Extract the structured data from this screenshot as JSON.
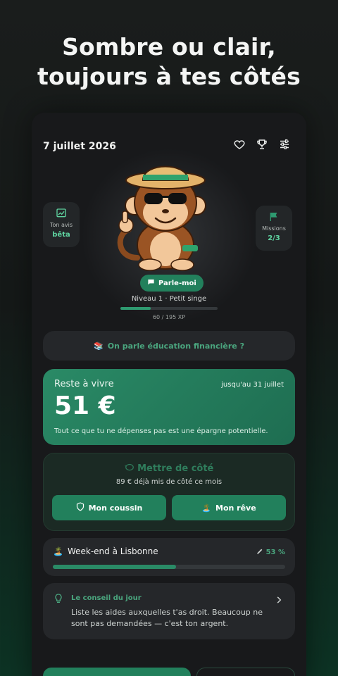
{
  "headline": {
    "line1": "Sombre ou clair,",
    "line2": "toujours à tes côtés"
  },
  "topbar": {
    "date": "7 juillet 2026",
    "icons": [
      "heart-icon",
      "trophy-icon",
      "sliders-icon"
    ]
  },
  "side_left": {
    "label": "Ton avis",
    "value": "bêta",
    "icon": "chart-icon"
  },
  "side_right": {
    "label": "Missions",
    "value": "2/3",
    "icon": "flag-icon"
  },
  "talk_button": {
    "label": "Parle-moi"
  },
  "level": {
    "title": "Niveau 1 · Petit singe",
    "xp_text": "60 / 195 XP",
    "xp_fraction": 0.31
  },
  "education": {
    "emoji": "📚",
    "label": "On parle éducation financière ?"
  },
  "budget": {
    "title": "Reste à vivre",
    "until": "jusqu'au 31 juillet",
    "amount": "51 €",
    "note": "Tout ce que tu ne dépenses pas est une épargne potentielle."
  },
  "savings": {
    "title": "Mettre de côté",
    "subtitle": "89 € déjà mis de côté ce mois",
    "btn_cushion": "Mon coussin",
    "btn_dream": "Mon rêve",
    "dream_emoji": "🏝️"
  },
  "goal": {
    "emoji": "🏝️",
    "name": "Week-end à Lisbonne",
    "percent": "53 %",
    "fraction": 0.53
  },
  "tip": {
    "title": "Le conseil du jour",
    "text": "Liste les aides auxquelles t'as droit. Beaucoup ne sont pas demandées — c'est ton argent."
  },
  "colors": {
    "accent": "#22805c",
    "accent_text": "#4aa57e",
    "card": "#25272a",
    "background": "#18191b"
  }
}
